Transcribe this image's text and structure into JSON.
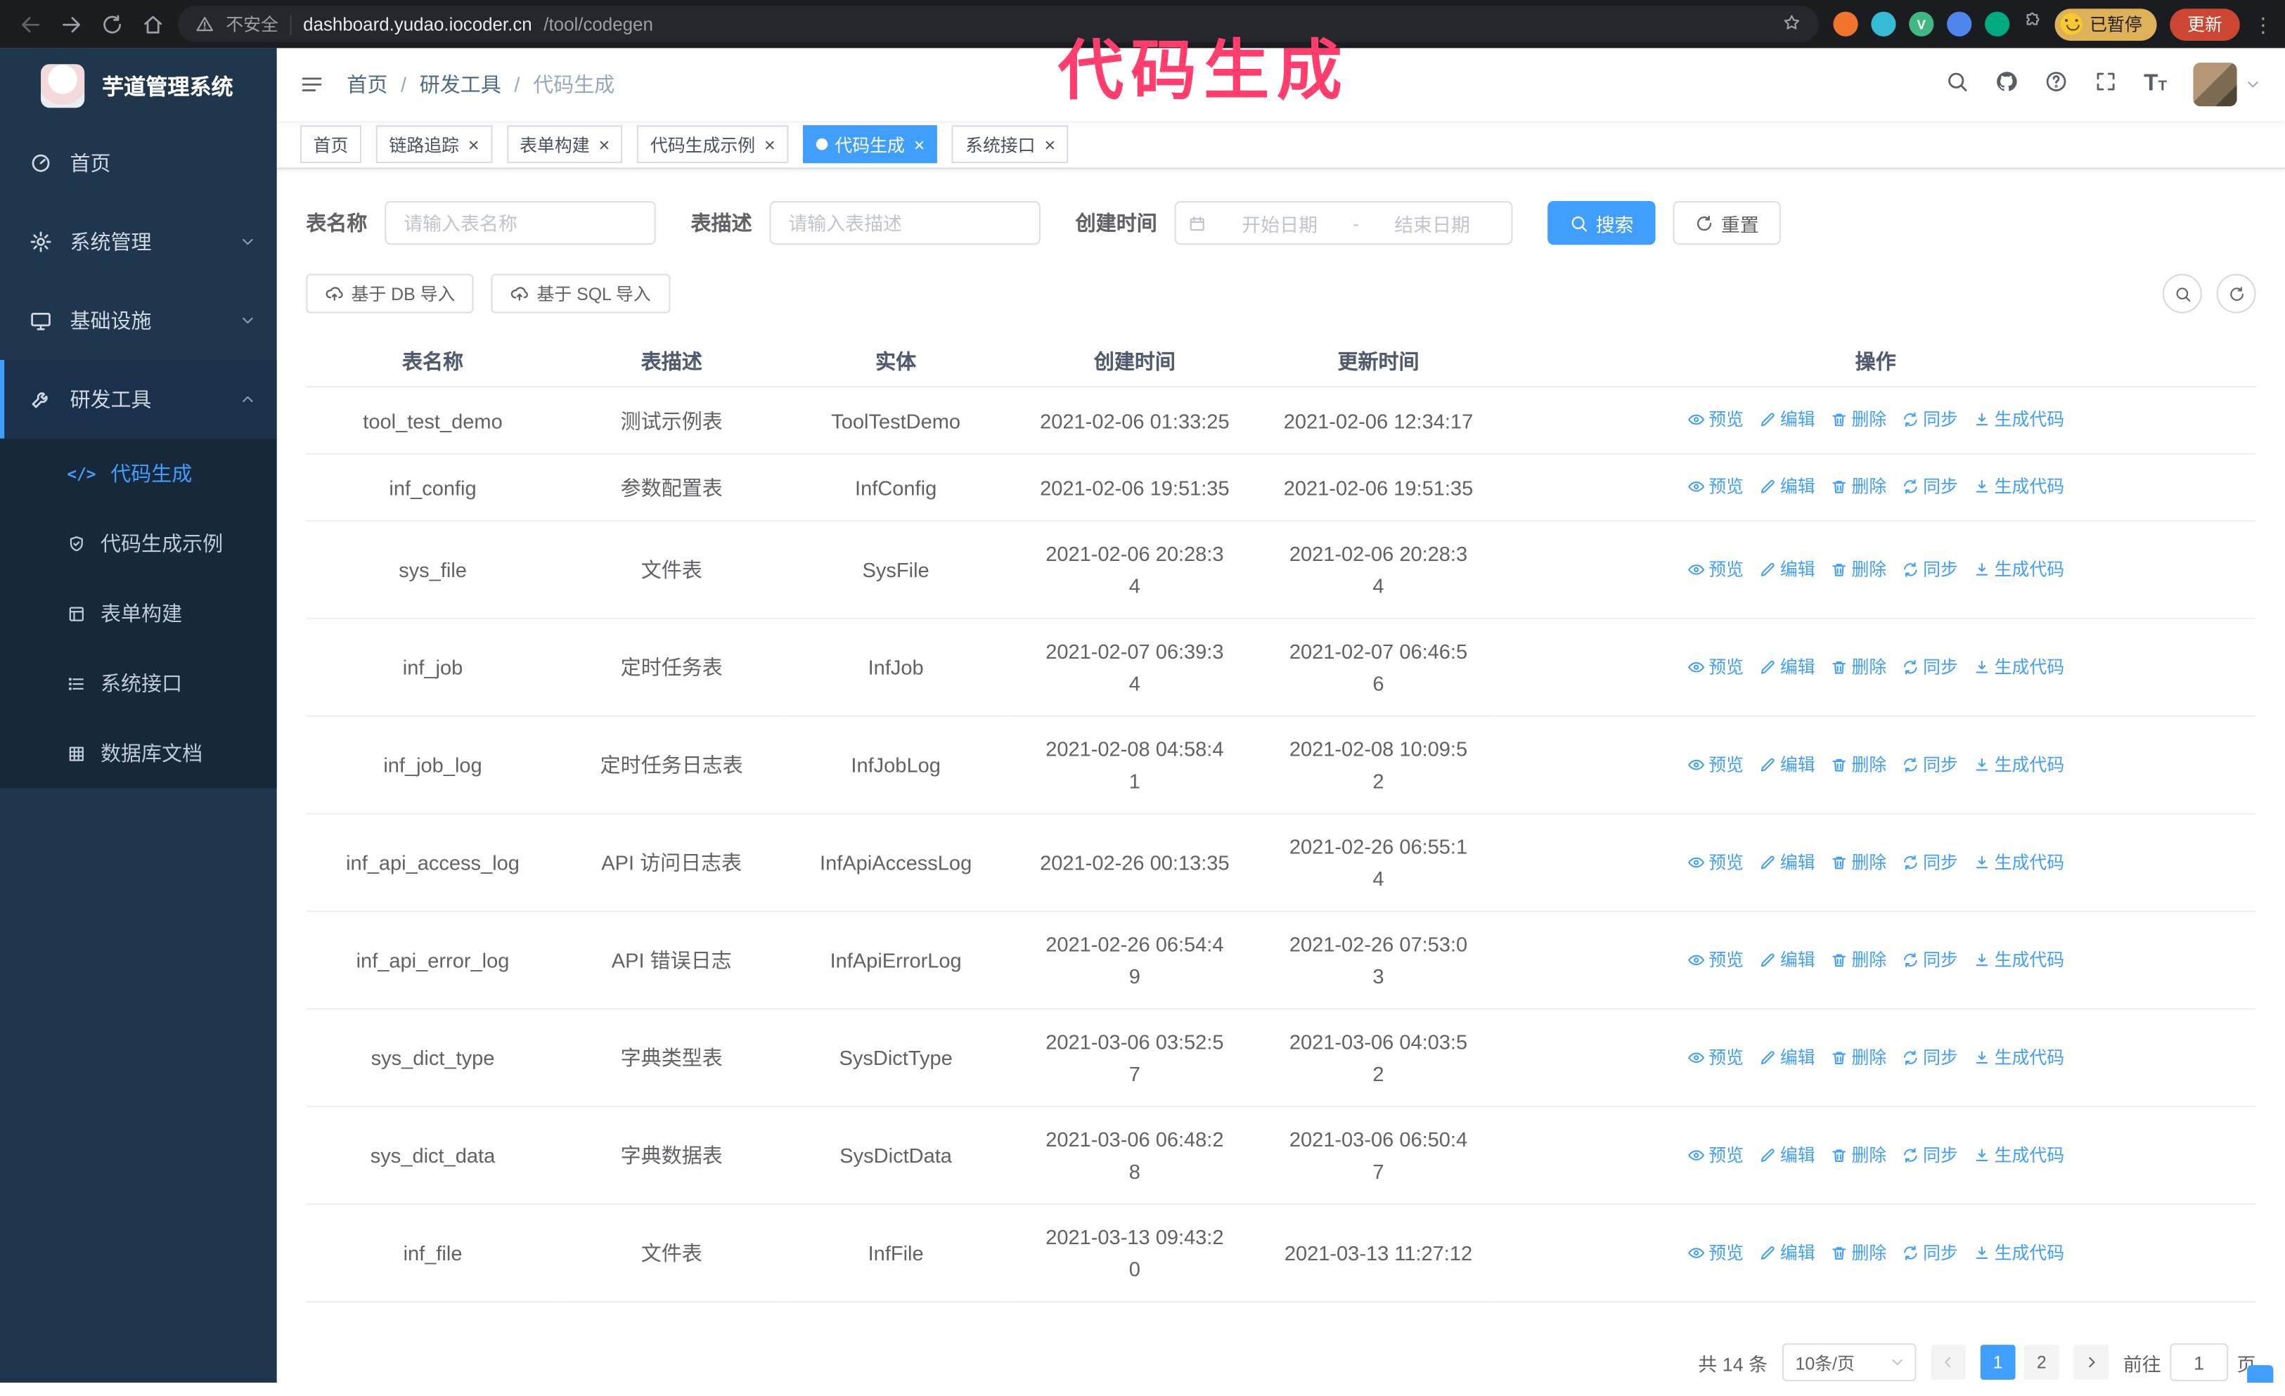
{
  "colors": {
    "accent": "#409eff",
    "sidebar_bg": "#20364d",
    "submenu_bg": "#17283a",
    "annotation": "#ff3e6e",
    "update_chip": "#cd4631",
    "paused_chip": "#dcb158"
  },
  "annotation": {
    "text": "代码生成"
  },
  "browser": {
    "security_label": "不安全",
    "url_host": "dashboard.yudao.iocoder.cn",
    "url_path": "/tool/codegen",
    "ext_v_letter": "V",
    "paused_badge": "已暂停",
    "update_button": "更新",
    "kebab": "⋮"
  },
  "sidebar": {
    "app_title": "芋道管理系统",
    "items": [
      {
        "label": "首页"
      },
      {
        "label": "系统管理"
      },
      {
        "label": "基础设施"
      },
      {
        "label": "研发工具"
      }
    ],
    "submenu": [
      {
        "label": "代码生成",
        "active": true
      },
      {
        "label": "代码生成示例"
      },
      {
        "label": "表单构建"
      },
      {
        "label": "系统接口"
      },
      {
        "label": "数据库文档"
      }
    ],
    "code_icon_glyph": "</>"
  },
  "breadcrumb": {
    "items": [
      "首页",
      "研发工具",
      "代码生成"
    ],
    "separator": "/"
  },
  "tabs": [
    {
      "label": "首页",
      "closable": false,
      "active": false
    },
    {
      "label": "链路追踪",
      "closable": true,
      "active": false
    },
    {
      "label": "表单构建",
      "closable": true,
      "active": false
    },
    {
      "label": "代码生成示例",
      "closable": true,
      "active": false
    },
    {
      "label": "代码生成",
      "closable": true,
      "active": true
    },
    {
      "label": "系统接口",
      "closable": true,
      "active": false
    }
  ],
  "filters": {
    "table_name_label": "表名称",
    "table_name_placeholder": "请输入表名称",
    "table_desc_label": "表描述",
    "table_desc_placeholder": "请输入表描述",
    "create_time_label": "创建时间",
    "date_start_placeholder": "开始日期",
    "date_separator": "-",
    "date_end_placeholder": "结束日期",
    "search_button": "搜索",
    "reset_button": "重置"
  },
  "toolbar": {
    "import_db": "基于 DB 导入",
    "import_sql": "基于 SQL 导入"
  },
  "table": {
    "columns": [
      "表名称",
      "表描述",
      "实体",
      "创建时间",
      "更新时间",
      "操作"
    ],
    "actions": [
      "预览",
      "编辑",
      "删除",
      "同步",
      "生成代码"
    ],
    "rows": [
      {
        "name": "tool_test_demo",
        "desc": "测试示例表",
        "entity": "ToolTestDemo",
        "created": "2021-02-06 01:33:25",
        "updated": "2021-02-06 12:34:17"
      },
      {
        "name": "inf_config",
        "desc": "参数配置表",
        "entity": "InfConfig",
        "created": "2021-02-06 19:51:35",
        "updated": "2021-02-06 19:51:35"
      },
      {
        "name": "sys_file",
        "desc": "文件表",
        "entity": "SysFile",
        "created": "2021-02-06 20:28:3\n4",
        "updated": "2021-02-06 20:28:3\n4"
      },
      {
        "name": "inf_job",
        "desc": "定时任务表",
        "entity": "InfJob",
        "created": "2021-02-07 06:39:3\n4",
        "updated": "2021-02-07 06:46:5\n6"
      },
      {
        "name": "inf_job_log",
        "desc": "定时任务日志表",
        "entity": "InfJobLog",
        "created": "2021-02-08 04:58:4\n1",
        "updated": "2021-02-08 10:09:5\n2"
      },
      {
        "name": "inf_api_access_log",
        "desc": "API 访问日志表",
        "entity": "InfApiAccessLog",
        "created": "2021-02-26 00:13:35",
        "updated": "2021-02-26 06:55:1\n4"
      },
      {
        "name": "inf_api_error_log",
        "desc": "API 错误日志",
        "entity": "InfApiErrorLog",
        "created": "2021-02-26 06:54:4\n9",
        "updated": "2021-02-26 07:53:0\n3"
      },
      {
        "name": "sys_dict_type",
        "desc": "字典类型表",
        "entity": "SysDictType",
        "created": "2021-03-06 03:52:5\n7",
        "updated": "2021-03-06 04:03:5\n2"
      },
      {
        "name": "sys_dict_data",
        "desc": "字典数据表",
        "entity": "SysDictData",
        "created": "2021-03-06 06:48:2\n8",
        "updated": "2021-03-06 06:50:4\n7"
      },
      {
        "name": "inf_file",
        "desc": "文件表",
        "entity": "InfFile",
        "created": "2021-03-13 09:43:2\n0",
        "updated": "2021-03-13 11:27:12"
      }
    ]
  },
  "pagination": {
    "total": "共 14 条",
    "page_size": "10条/页",
    "pages": [
      "1",
      "2"
    ],
    "active_page": "1",
    "goto_label": "前往",
    "goto_value": "1",
    "goto_suffix": "页"
  }
}
